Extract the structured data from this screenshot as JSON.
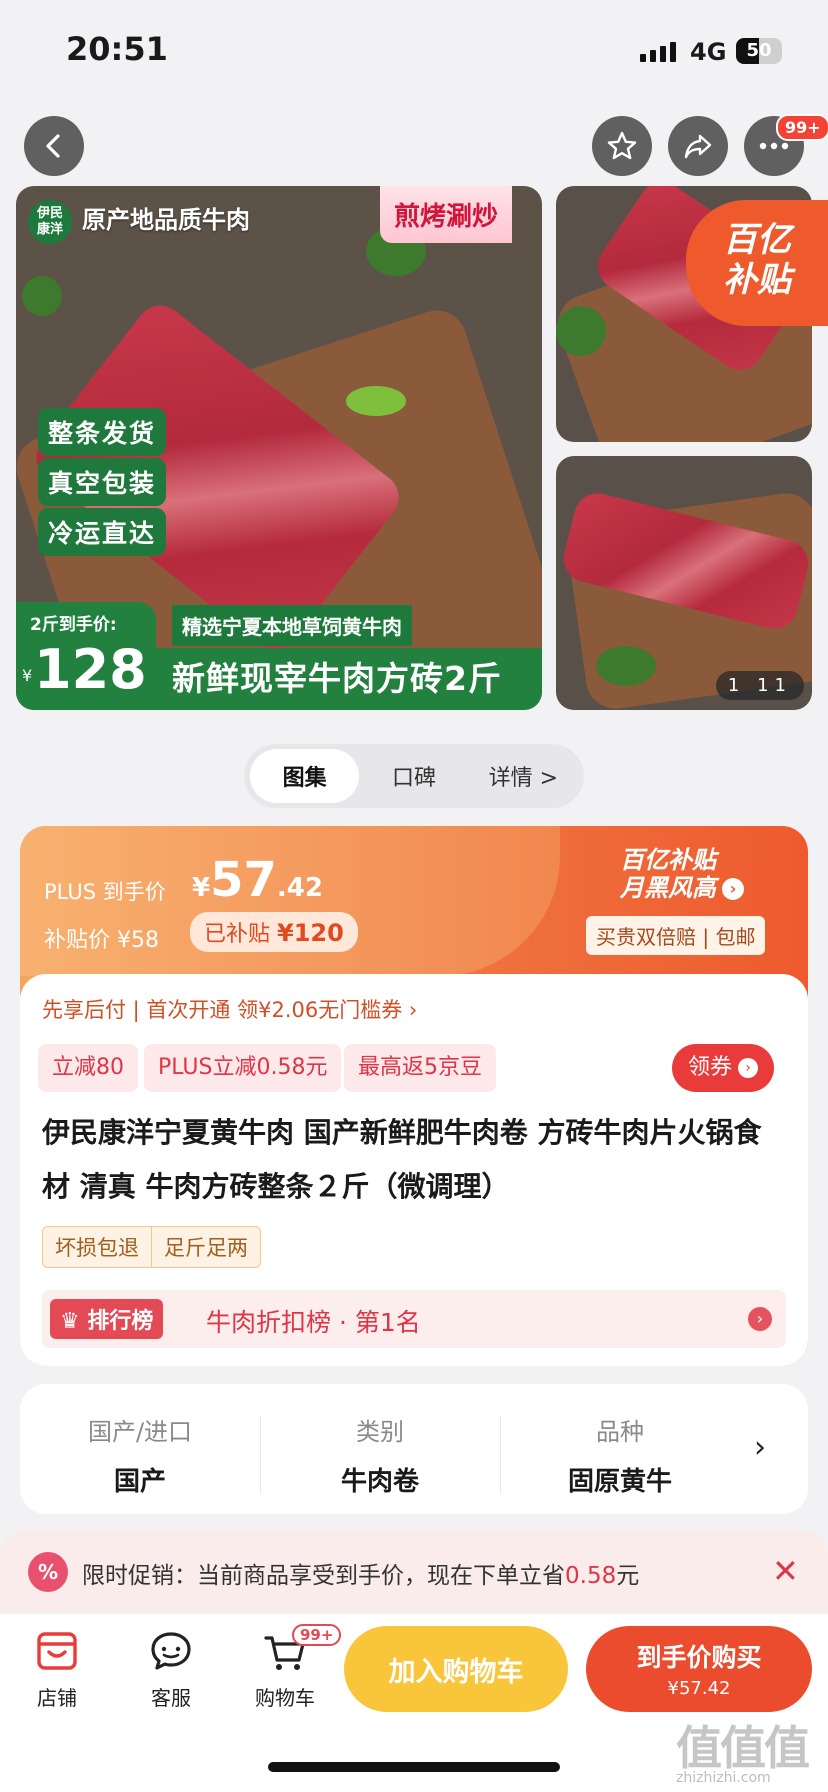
{
  "status": {
    "time": "20:51",
    "network": "4G",
    "battery": "50",
    "battery_fraction": 0.5
  },
  "topbar": {
    "notification_badge": "99+"
  },
  "gallery": {
    "brand_chip": "伊民\n康洋",
    "origin_text": "原产地品质牛肉",
    "cook_tag": "煎烤涮炒",
    "green_tags": [
      "整条发货",
      "真空包装",
      "冷运直达"
    ],
    "price_label": "2斤到手价:",
    "price_symbol": "¥",
    "price_value": "128",
    "sub_banner": "精选宁夏本地草饲黄牛肉",
    "big_title": "新鲜现宰牛肉方砖2斤",
    "counter_current": "1",
    "counter_total": "11",
    "subsidy_badge_line1": "百亿",
    "subsidy_badge_line2": "补贴"
  },
  "tabs": [
    {
      "label": "图集",
      "active": true
    },
    {
      "label": "口碑",
      "active": false
    },
    {
      "label": "详情 >",
      "active": false
    }
  ],
  "price_card": {
    "plus_label": "PLUS 到手价",
    "plus_price_symbol": "¥",
    "plus_price_int": "57",
    "plus_price_dec": ".42",
    "subsidy_label": "补贴价 ¥58",
    "subsidy_amount_prefix": "已补贴 ",
    "subsidy_amount": "¥120",
    "brand_line1": "百亿补贴",
    "brand_line2": "月黑风高",
    "guarantee": "买贵双倍赔 | 包邮",
    "pay_later": "先享后付 | 首次开通 领¥2.06无门槛券 ›",
    "chips": [
      "立减80",
      "PLUS立减0.58元",
      "最高返5京豆"
    ],
    "coupon_button": "领券",
    "title": "伊民康洋宁夏黄牛肉 国产新鲜肥牛肉卷 方砖牛肉片火锅食材 清真 牛肉方砖整条２斤（微调理）",
    "tags": [
      "坏损包退",
      "足斤足两"
    ],
    "rank_tag": "排行榜",
    "rank_text": "牛肉折扣榜 · 第1名"
  },
  "attributes": [
    {
      "key": "国产/进口",
      "value": "国产"
    },
    {
      "key": "类别",
      "value": "牛肉卷"
    },
    {
      "key": "品种",
      "value": "固原黄牛"
    }
  ],
  "promo": {
    "icon": "%",
    "text_prefix": "限时促销：当前商品享受到手价，现在下单立省",
    "saving": "0.58",
    "text_suffix": "元",
    "close": "✕"
  },
  "bottom_bar": {
    "store": "店铺",
    "service": "客服",
    "cart": "购物车",
    "cart_badge": "99+",
    "add_to_cart": "加入购物车",
    "buy_now": "到手价购买",
    "buy_now_price": "¥57.42"
  },
  "watermark": {
    "logo": "值值值",
    "url": "zhizhizhi.com"
  },
  "colors": {
    "accent": "#ee5a2e",
    "green": "#22813f",
    "red": "#e03447",
    "yellow": "#f9c53a"
  }
}
